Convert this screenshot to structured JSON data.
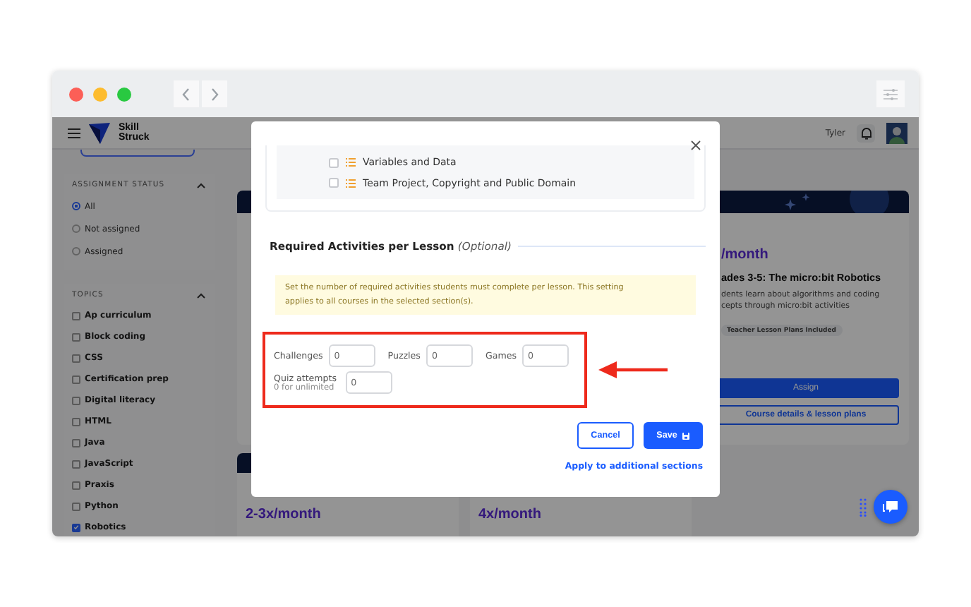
{
  "header": {
    "logo_lines": [
      "Skill",
      "Struck"
    ],
    "user_name": "Tyler"
  },
  "sidebar": {
    "assignment_status": {
      "title": "ASSIGNMENT STATUS",
      "options": [
        {
          "label": "All",
          "selected": true
        },
        {
          "label": "Not assigned",
          "selected": false
        },
        {
          "label": "Assigned",
          "selected": false
        }
      ]
    },
    "topics": {
      "title": "TOPICS",
      "items": [
        {
          "label": "Ap curriculum",
          "checked": false
        },
        {
          "label": "Block coding",
          "checked": false
        },
        {
          "label": "CSS",
          "checked": false
        },
        {
          "label": "Certification prep",
          "checked": false
        },
        {
          "label": "Digital literacy",
          "checked": false
        },
        {
          "label": "HTML",
          "checked": false
        },
        {
          "label": "Java",
          "checked": false
        },
        {
          "label": "JavaScript",
          "checked": false
        },
        {
          "label": "Praxis",
          "checked": false
        },
        {
          "label": "Python",
          "checked": false
        },
        {
          "label": "Robotics",
          "checked": true
        }
      ]
    }
  },
  "course_card": {
    "frequency": "/month",
    "title": "ades 3-5: The micro:bit Robotics",
    "description": [
      "dents learn about algorithms and coding",
      "cepts through micro:bit activities"
    ],
    "tag": "Teacher Lesson Plans Included",
    "assign_button": "Assign",
    "details_button": "Course details & lesson plans"
  },
  "lower_cards": [
    {
      "frequency": "2-3x/month"
    },
    {
      "frequency": "4x/month"
    }
  ],
  "modal": {
    "lessons": [
      {
        "label": "Variables and Data",
        "checked": false
      },
      {
        "label": "Team Project, Copyright and Public Domain",
        "checked": false
      }
    ],
    "section_title": "Required Activities per Lesson",
    "section_optional": "(Optional)",
    "notice": "Set the number of required activities students must complete per lesson. This setting applies to all courses in the selected section(s).",
    "fields": [
      {
        "label": "Challenges",
        "value": "0"
      },
      {
        "label": "Puzzles",
        "value": "0"
      },
      {
        "label": "Games",
        "value": "0"
      }
    ],
    "quiz": {
      "label": "Quiz attempts",
      "hint": "0 for unlimited",
      "value": "0"
    },
    "cancel_button": "Cancel",
    "save_button": "Save",
    "apply_link": "Apply to additional sections"
  }
}
